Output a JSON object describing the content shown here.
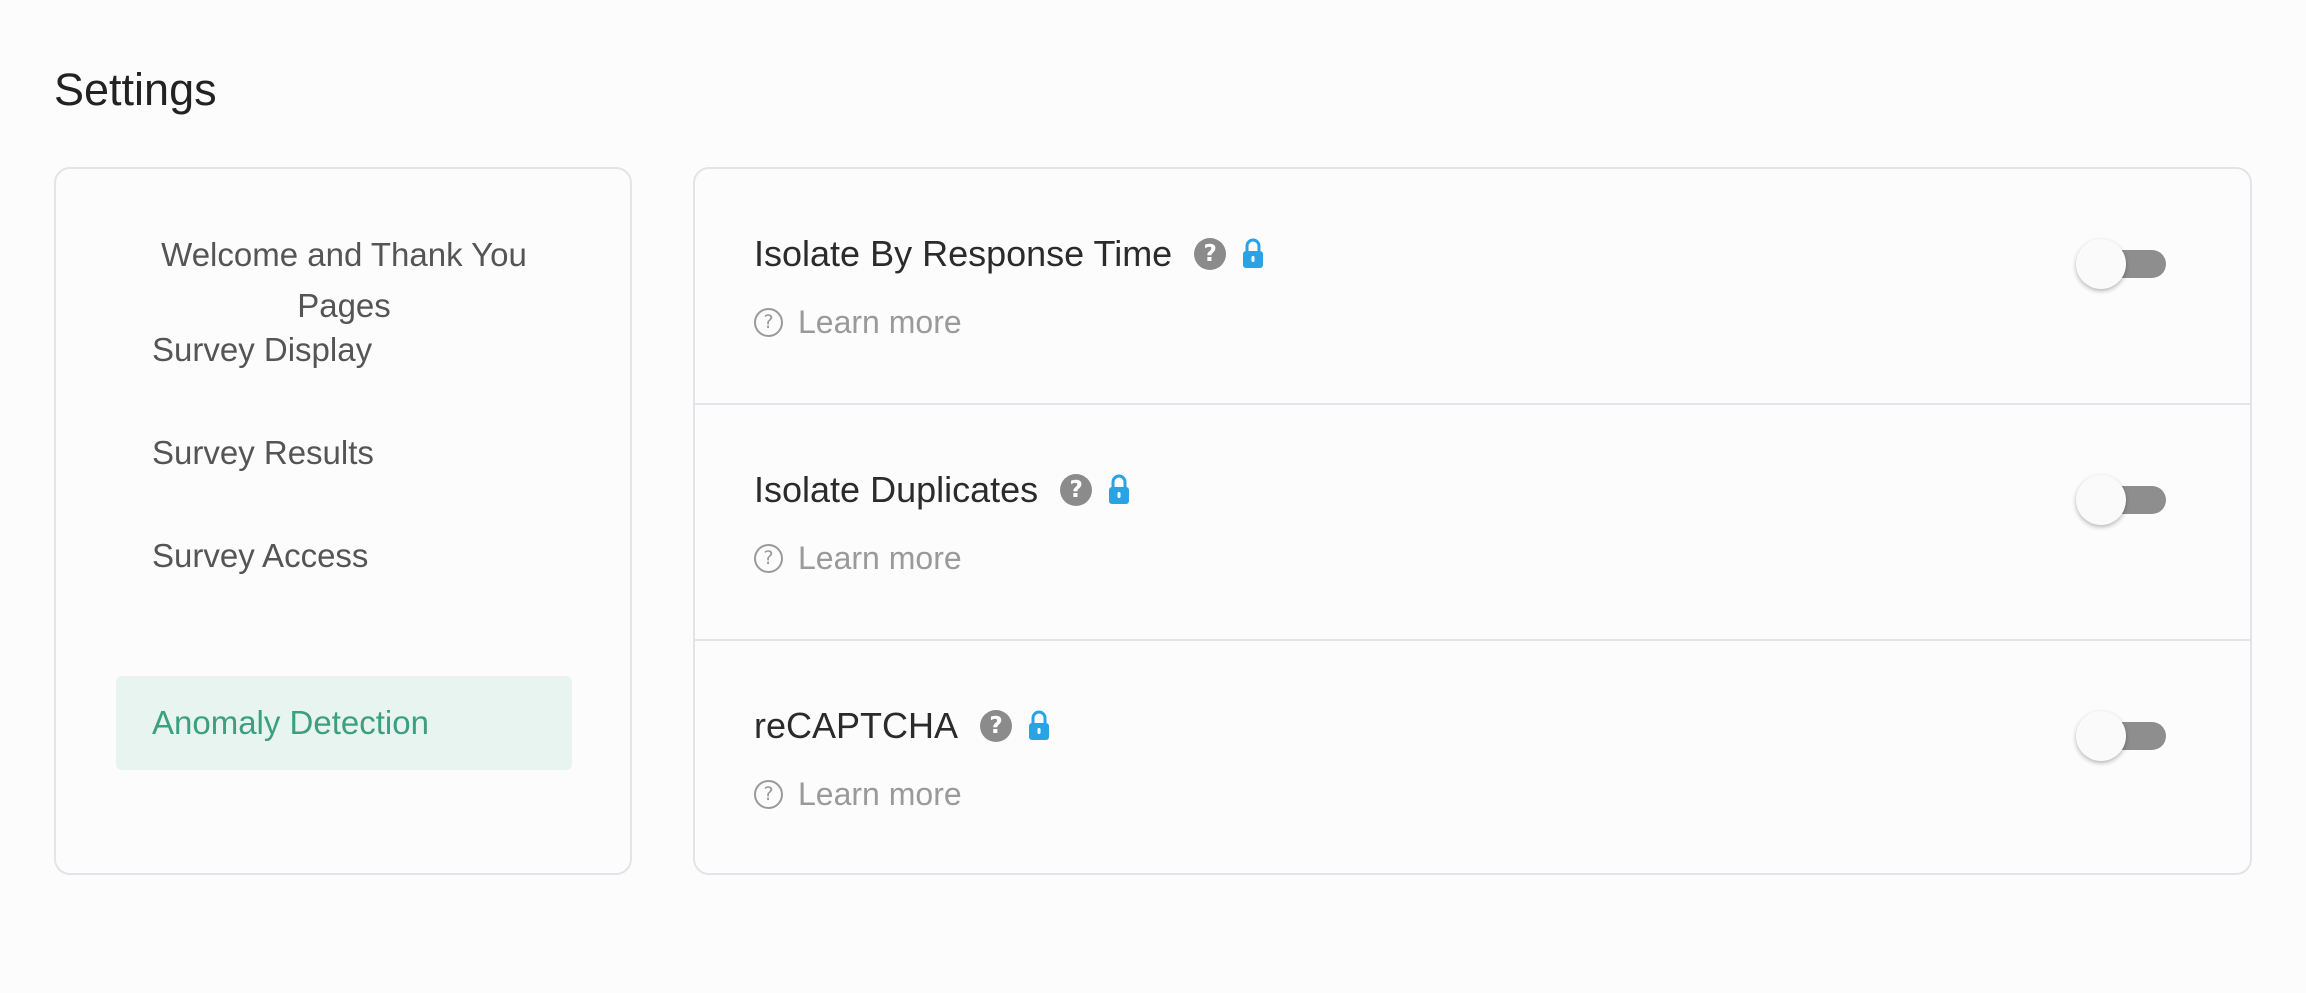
{
  "page": {
    "title": "Settings"
  },
  "sidebar": {
    "items": [
      {
        "label": "Welcome and Thank You Pages",
        "active": false
      },
      {
        "label": "Survey Display",
        "active": false
      },
      {
        "label": "Survey Results",
        "active": false
      },
      {
        "label": "Survey Access",
        "active": false
      },
      {
        "label": "Anomaly Detection",
        "active": true
      }
    ]
  },
  "settings": [
    {
      "title": "Isolate By Response Time",
      "learn_more": "Learn more",
      "enabled": false,
      "help_icon": "question-circle-icon",
      "lock_icon": "lock-icon"
    },
    {
      "title": "Isolate Duplicates",
      "learn_more": "Learn more",
      "enabled": false,
      "help_icon": "question-circle-icon",
      "lock_icon": "lock-icon"
    },
    {
      "title": "reCAPTCHA",
      "learn_more": "Learn more",
      "enabled": false,
      "help_icon": "question-circle-icon",
      "lock_icon": "lock-icon"
    }
  ],
  "colors": {
    "accent": "#3c9f80",
    "active_bg": "#e7f4f0",
    "lock": "#2aa3e6",
    "toggle_off": "#8e8e8e"
  }
}
